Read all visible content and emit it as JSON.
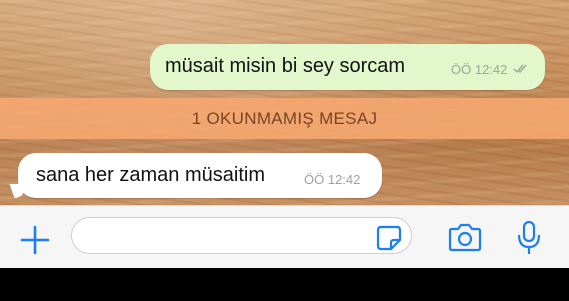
{
  "messages": {
    "outgoing": {
      "text": "müsait misin bi sey sorcam",
      "time": "ÖÖ 12:42",
      "status_icon": "double-check-icon"
    },
    "unread_banner": "1 OKUNMAMIŞ MESAJ",
    "incoming": {
      "text": "sana her zaman müsaitim",
      "time": "ÖÖ 12:42"
    }
  },
  "input_bar": {
    "field_value": "",
    "icons": [
      "plus-icon",
      "sticker-icon",
      "camera-icon",
      "microphone-icon"
    ],
    "accent_color": "#1a7ef5"
  },
  "colors": {
    "outgoing_bubble": "#e2f7cb",
    "incoming_bubble": "#ffffff",
    "unread_banner": "#f6a870"
  }
}
